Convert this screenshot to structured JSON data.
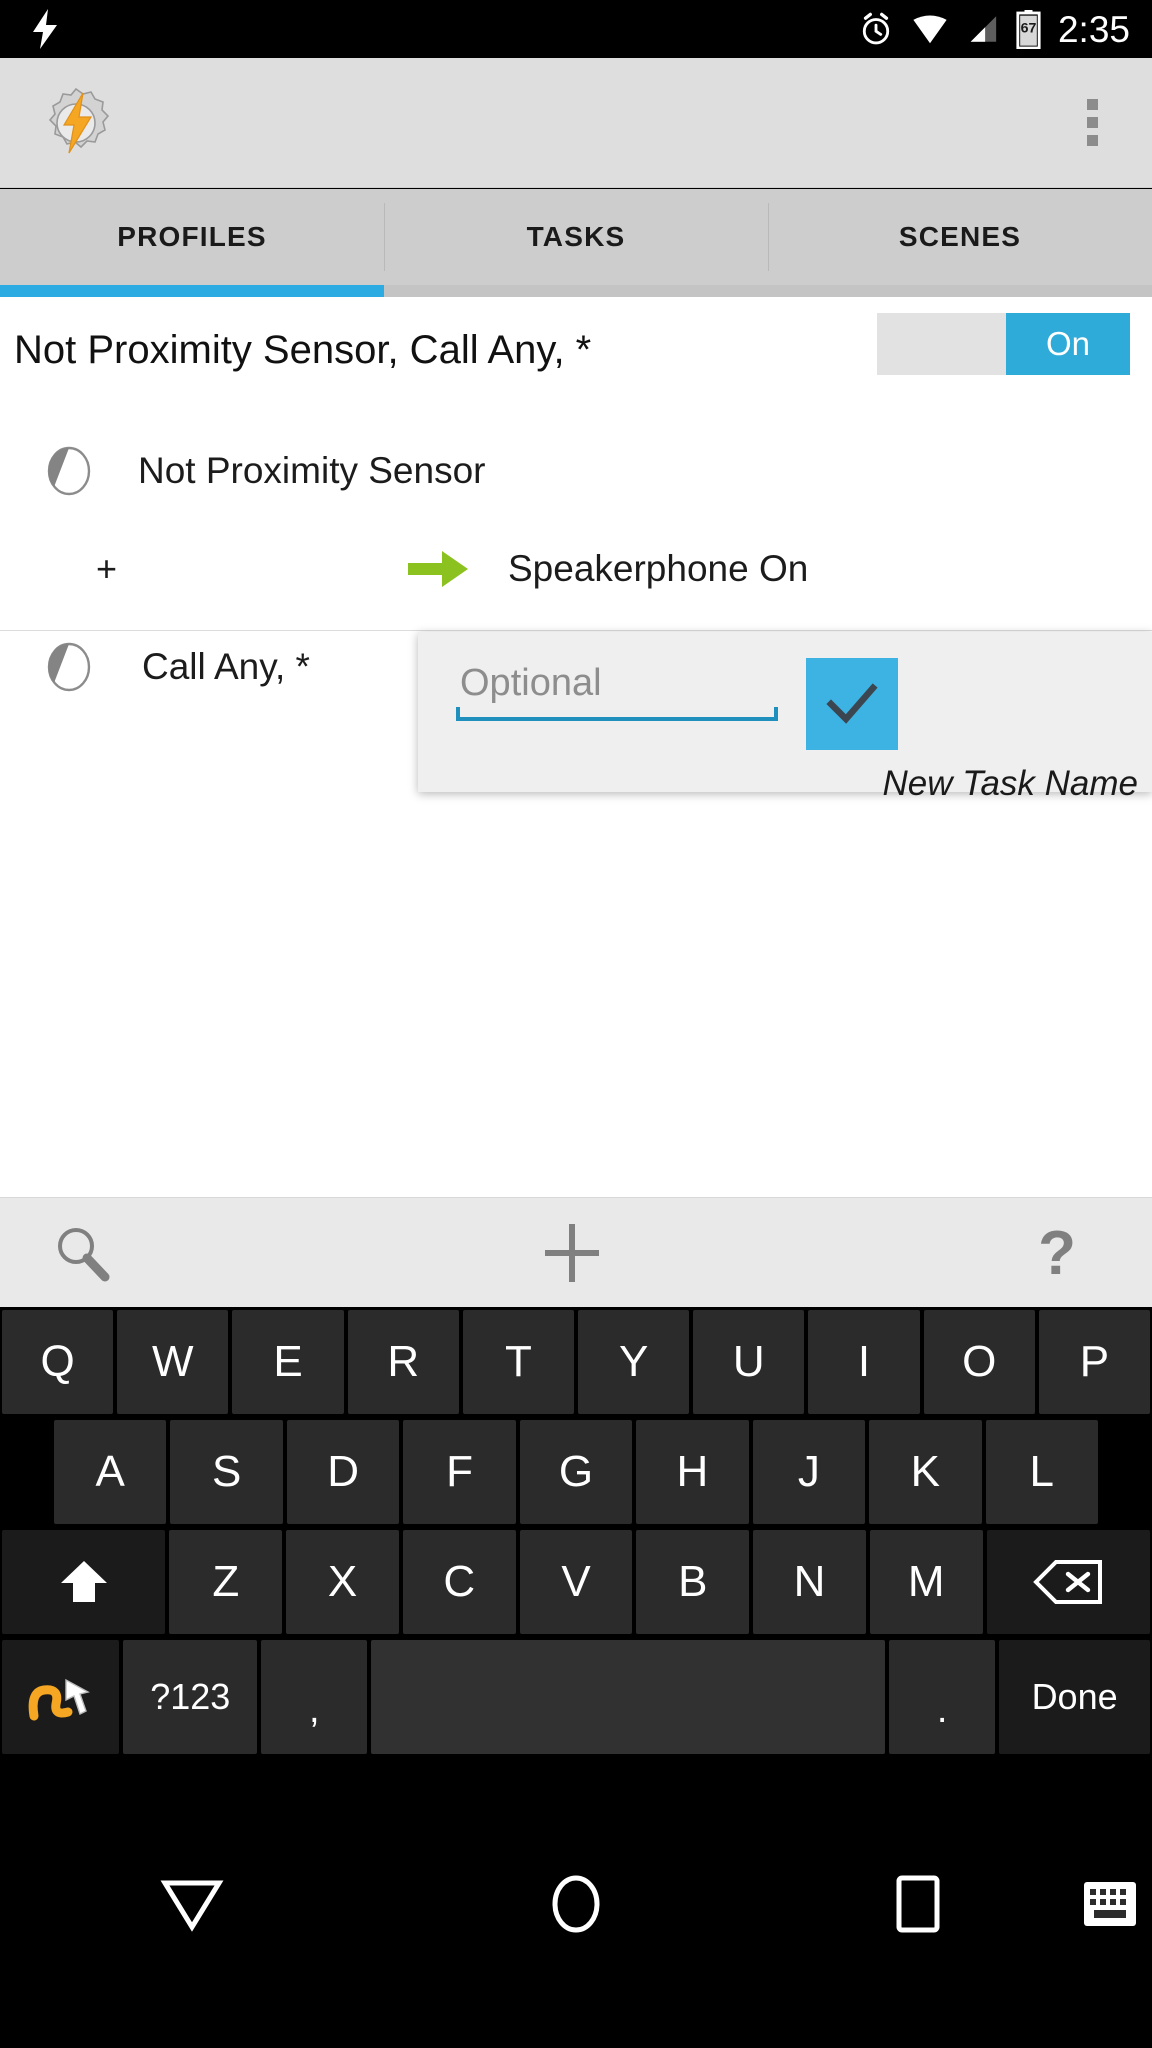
{
  "status_bar": {
    "left_icon": "lightning-bolt-icon",
    "icons": [
      "alarm-clock-icon",
      "wifi-icon",
      "cellular-signal-icon",
      "battery-icon"
    ],
    "battery_level": "67",
    "time": "2:35"
  },
  "app_bar": {
    "logo": "tasker-gear-bolt-logo",
    "overflow_menu": "overflow-menu-icon"
  },
  "tabs": [
    {
      "label": "PROFILES",
      "active": true
    },
    {
      "label": "TASKS",
      "active": false
    },
    {
      "label": "SCENES",
      "active": false
    }
  ],
  "profile": {
    "title": "Not Proximity Sensor, Call Any, *",
    "toggle_label": "On",
    "toggle_state": "on",
    "contexts": [
      {
        "icon": "state-context-icon",
        "label": "Not Proximity Sensor"
      },
      {
        "icon": "state-context-icon",
        "label": "Call Any, *"
      }
    ],
    "link_row": {
      "plus": "+",
      "arrow_icon": "green-right-arrow-icon",
      "action_label": "Speakerphone On"
    }
  },
  "dialog": {
    "input_value": "",
    "input_placeholder": "Optional",
    "confirm_icon": "checkmark-icon",
    "caption": "New Task Name"
  },
  "toolbar": {
    "search": "search-icon",
    "add": "add-icon",
    "help": "help-icon"
  },
  "keyboard": {
    "row1": [
      "Q",
      "W",
      "E",
      "R",
      "T",
      "Y",
      "U",
      "I",
      "O",
      "P"
    ],
    "row2": [
      "A",
      "S",
      "D",
      "F",
      "G",
      "H",
      "J",
      "K",
      "L"
    ],
    "row3_letters": [
      "Z",
      "X",
      "C",
      "V",
      "B",
      "N",
      "M"
    ],
    "shift": "shift-icon",
    "backspace": "backspace-icon",
    "swipe": "swipe-gesture-icon",
    "symbols": "?123",
    "comma": ",",
    "space": "",
    "period": ".",
    "done": "Done"
  },
  "nav_bar": {
    "back": "back-triangle-icon",
    "home": "home-circle-icon",
    "recents": "recents-square-icon",
    "keyboard": "keyboard-icon"
  },
  "colors": {
    "accent_blue": "#2cabe2",
    "toggle_blue": "#2fabd9",
    "checkmark_blue": "#3cb3e3",
    "underline_blue": "#1f8fbd",
    "arrow_green": "#8bc220",
    "logo_orange": "#f5a623",
    "appbar_gray": "#dedede",
    "tabbar_gray": "#cdcdcd",
    "toolbar_gray": "#e9e9e9",
    "dialog_gray": "#efefef"
  }
}
